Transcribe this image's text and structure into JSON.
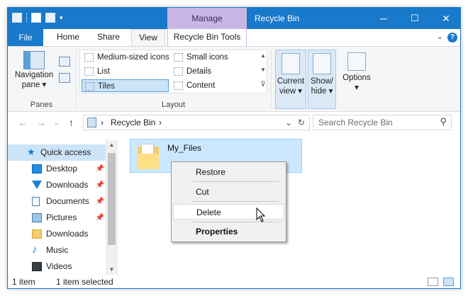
{
  "window": {
    "title": "Recycle Bin",
    "context_tab": "Manage",
    "controls": {
      "minimize": "─",
      "maximize": "☐",
      "close": "✕"
    }
  },
  "qat": {
    "dropdown": "▾"
  },
  "ribbon_tabs": {
    "file": "File",
    "home": "Home",
    "share": "Share",
    "view": "View",
    "recycle_bin_tools": "Recycle Bin Tools",
    "help": "?",
    "collapse": "⌄"
  },
  "ribbon": {
    "panes": {
      "navigation_pane": "Navigation",
      "navigation_pane_line2": "pane ▾",
      "group": "Panes"
    },
    "layout": {
      "items": [
        "Medium-sized icons",
        "Small icons",
        "List",
        "Details",
        "Tiles",
        "Content"
      ],
      "selected": "Tiles",
      "group": "Layout",
      "scroll_up": "▲",
      "scroll_down": "▼",
      "more": "⊽"
    },
    "current_view": {
      "line1": "Current",
      "line2": "view ▾"
    },
    "show_hide": {
      "line1": "Show/",
      "line2": "hide ▾"
    },
    "options": {
      "line1": "Options",
      "line2": "▾"
    }
  },
  "address": {
    "back": "←",
    "forward": "→",
    "recent": "⌄",
    "up": "↑",
    "sep1": "›",
    "location": "Recycle Bin",
    "sep2": "›",
    "dropdown": "⌄",
    "refresh": "↻",
    "search_placeholder": "Search Recycle Bin",
    "search_icon": "⚲"
  },
  "nav_pane": {
    "items": [
      {
        "label": "Quick access",
        "icon": "star-icon",
        "pinned": false,
        "selected": true
      },
      {
        "label": "Desktop",
        "icon": "desktop-icon",
        "pinned": true
      },
      {
        "label": "Downloads",
        "icon": "download-arrow-icon",
        "pinned": true
      },
      {
        "label": "Documents",
        "icon": "documents-icon",
        "pinned": true
      },
      {
        "label": "Pictures",
        "icon": "pictures-icon",
        "pinned": true
      },
      {
        "label": "Downloads",
        "icon": "folder-icon",
        "pinned": false
      },
      {
        "label": "Music",
        "icon": "music-icon",
        "pinned": false
      },
      {
        "label": "Videos",
        "icon": "videos-icon",
        "pinned": false
      }
    ],
    "pin_glyph": "📌",
    "star_glyph": "★",
    "music_glyph": "♪",
    "scroll_up": "▲",
    "scroll_down": "▼"
  },
  "content": {
    "file_name": "My_Files"
  },
  "context_menu": {
    "restore": "Restore",
    "cut": "Cut",
    "delete": "Delete",
    "properties": "Properties"
  },
  "status": {
    "item_count": "1 item",
    "selection": "1 item selected"
  },
  "colors": {
    "title_bar": "#1979ca",
    "manage_tab": "#c9b6e4",
    "selection": "#cce4f7",
    "tile_selection": "#cce8ff",
    "folder": "#f2cc6d"
  }
}
